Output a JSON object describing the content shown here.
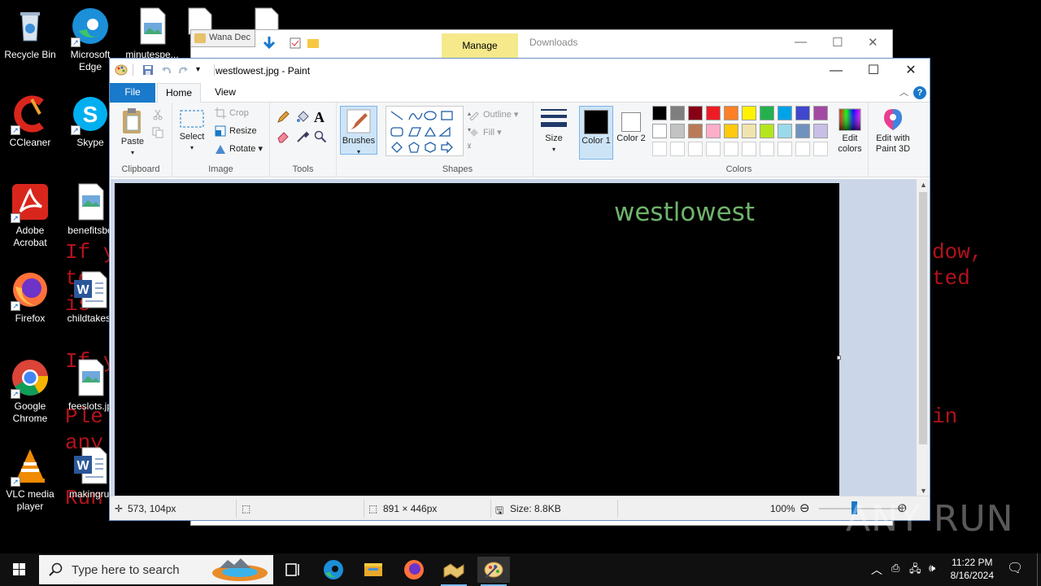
{
  "desktop": {
    "ransom_lines_left": [
      "If y",
      "to",
      "is",
      "If y",
      "Ple",
      "any",
      "Run"
    ],
    "ransom_lines_right": [
      "dow,",
      "ted",
      "in"
    ],
    "icons": [
      {
        "label": "Recycle Bin",
        "icon": "recycle-bin-icon"
      },
      {
        "label": "Microsoft Edge",
        "icon": "edge-icon"
      },
      {
        "label": "minutespe...",
        "icon": "image-file-icon"
      },
      {
        "label": "b",
        "icon": "file-icon"
      },
      {
        "label": "CCleaner",
        "icon": "ccleaner-icon"
      },
      {
        "label": "Skype",
        "icon": "skype-icon"
      },
      {
        "label": "Adobe Acrobat",
        "icon": "acrobat-icon"
      },
      {
        "label": "benefitsbe",
        "icon": "image-file-icon"
      },
      {
        "label": "Firefox",
        "icon": "firefox-icon"
      },
      {
        "label": "childtakes.",
        "icon": "word-doc-icon"
      },
      {
        "label": "Google Chrome",
        "icon": "chrome-icon"
      },
      {
        "label": "feeslots.jp",
        "icon": "image-file-icon"
      },
      {
        "label": "VLC media player",
        "icon": "vlc-icon"
      },
      {
        "label": "makingrul",
        "icon": "word-doc-icon"
      }
    ]
  },
  "explorer": {
    "wana_tab": "Wana Dec",
    "manage_label": "Manage",
    "downloads_label": "Downloads"
  },
  "paint": {
    "title": "westlowest.jpg - Paint",
    "tabs": {
      "file": "File",
      "home": "Home",
      "view": "View"
    },
    "help": "?",
    "ribbon": {
      "clipboard": {
        "paste": "Paste",
        "group": "Clipboard"
      },
      "image": {
        "select": "Select",
        "crop": "Crop",
        "resize": "Resize",
        "rotate": "Rotate",
        "group": "Image"
      },
      "tools": {
        "group": "Tools",
        "text_tool": "A"
      },
      "brushes": "Brushes",
      "shapes": {
        "outline": "Outline",
        "fill": "Fill",
        "group": "Shapes"
      },
      "size": "Size",
      "color1": "Color 1",
      "color2": "Color 2",
      "colors_group": "Colors",
      "edit_colors": "Edit colors",
      "paint3d": "Edit with Paint 3D"
    },
    "palette_row1": [
      "#000000",
      "#7f7f7f",
      "#880015",
      "#ed1c24",
      "#ff7f27",
      "#fff200",
      "#22b14c",
      "#00a2e8",
      "#3f48cc",
      "#a349a4"
    ],
    "palette_row2": [
      "#ffffff",
      "#c3c3c3",
      "#b97a57",
      "#ffaec9",
      "#ffc90e",
      "#efe4b0",
      "#b5e61d",
      "#99d9ea",
      "#7092be",
      "#c8bfe7"
    ],
    "color1_value": "#000000",
    "color2_value": "#ffffff",
    "canvas_text": "westlowest",
    "status": {
      "cursor_pos": "573, 104px",
      "image_size": "891 × 446px",
      "file_size": "Size: 8.8KB",
      "zoom": "100%"
    }
  },
  "taskbar": {
    "search_placeholder": "Type here to search",
    "time": "11:22 PM",
    "date": "8/16/2024"
  },
  "watermark": "ANY RUN"
}
